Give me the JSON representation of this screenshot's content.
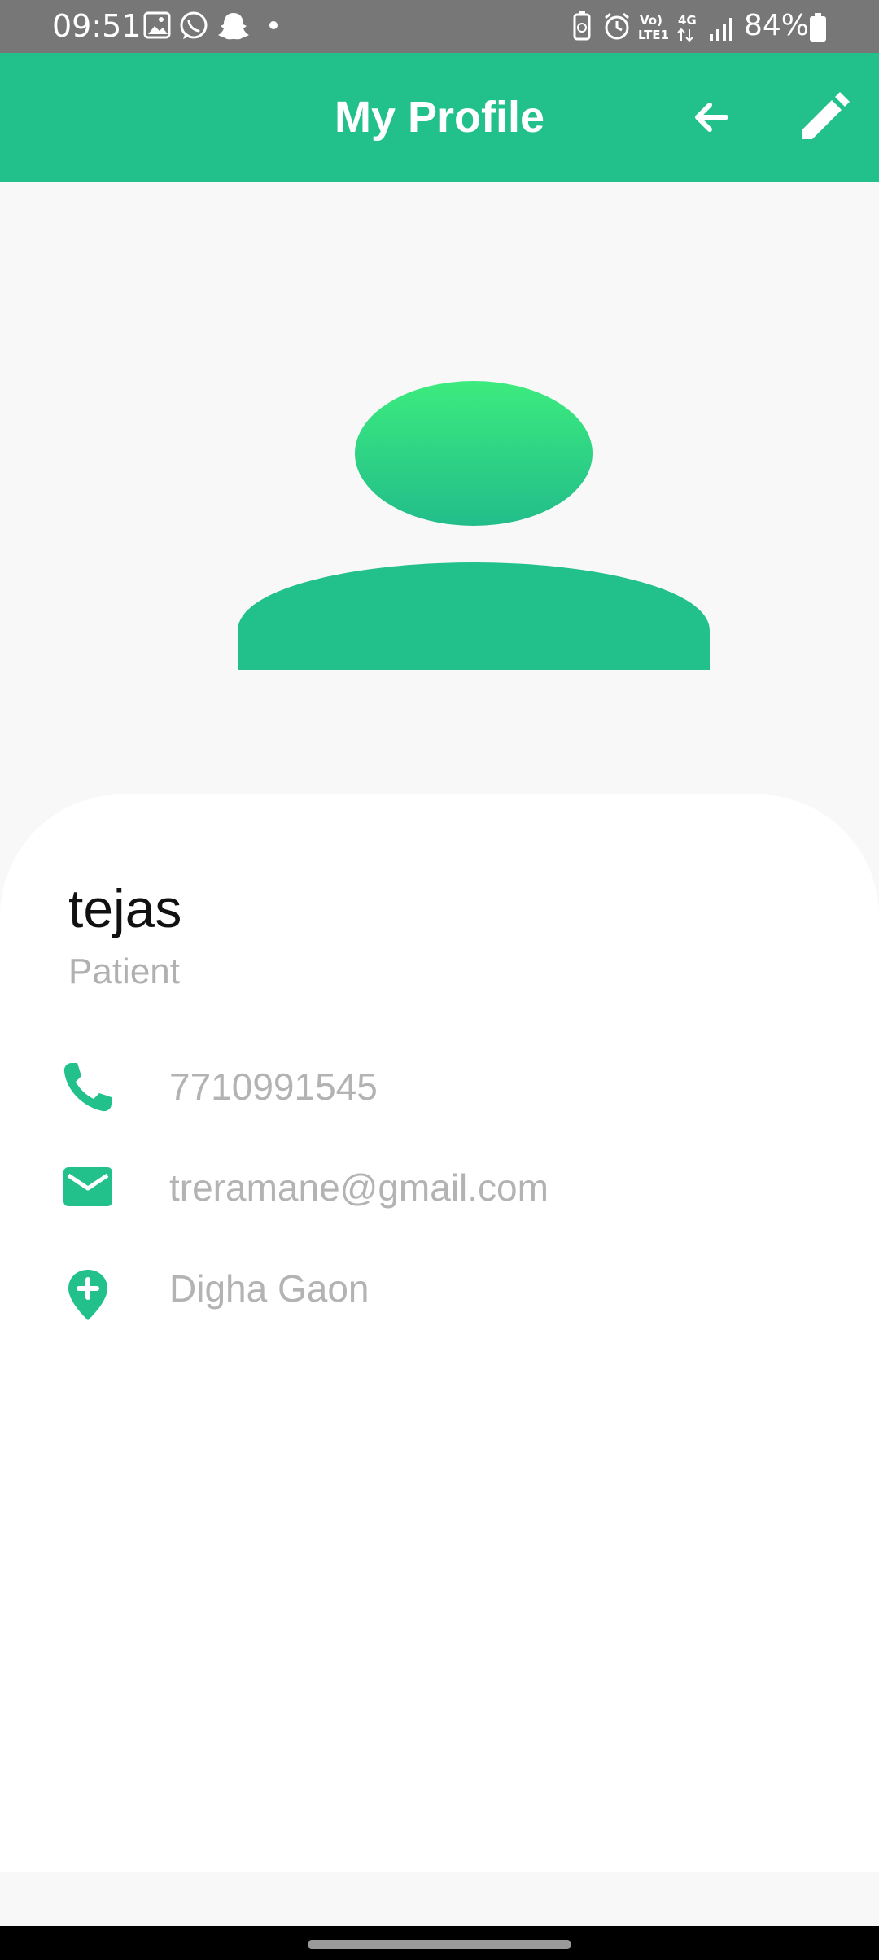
{
  "status_bar": {
    "time": "09:51",
    "battery": "84%",
    "network_top": "Vo)",
    "network_bottom": "LTE1",
    "network_type": "4G",
    "icons_left": [
      "gallery-icon",
      "whatsapp-icon",
      "snapchat-icon",
      "dot-icon"
    ],
    "icons_right": [
      "battery-saver-icon",
      "alarm-icon",
      "volte-icon",
      "signal-icon",
      "battery-icon"
    ]
  },
  "header": {
    "title": "My Profile",
    "back_icon": "arrow-left-icon",
    "edit_icon": "pencil-icon"
  },
  "profile": {
    "name": "tejas",
    "role": "Patient",
    "phone": "7710991545",
    "email": "treramane@gmail.com",
    "location": "Digha Gaon"
  },
  "colors": {
    "accent": "#22c08a",
    "accent_light": "#3ceb7e",
    "status_bar": "#777777",
    "muted_text": "#b3b3b3"
  }
}
